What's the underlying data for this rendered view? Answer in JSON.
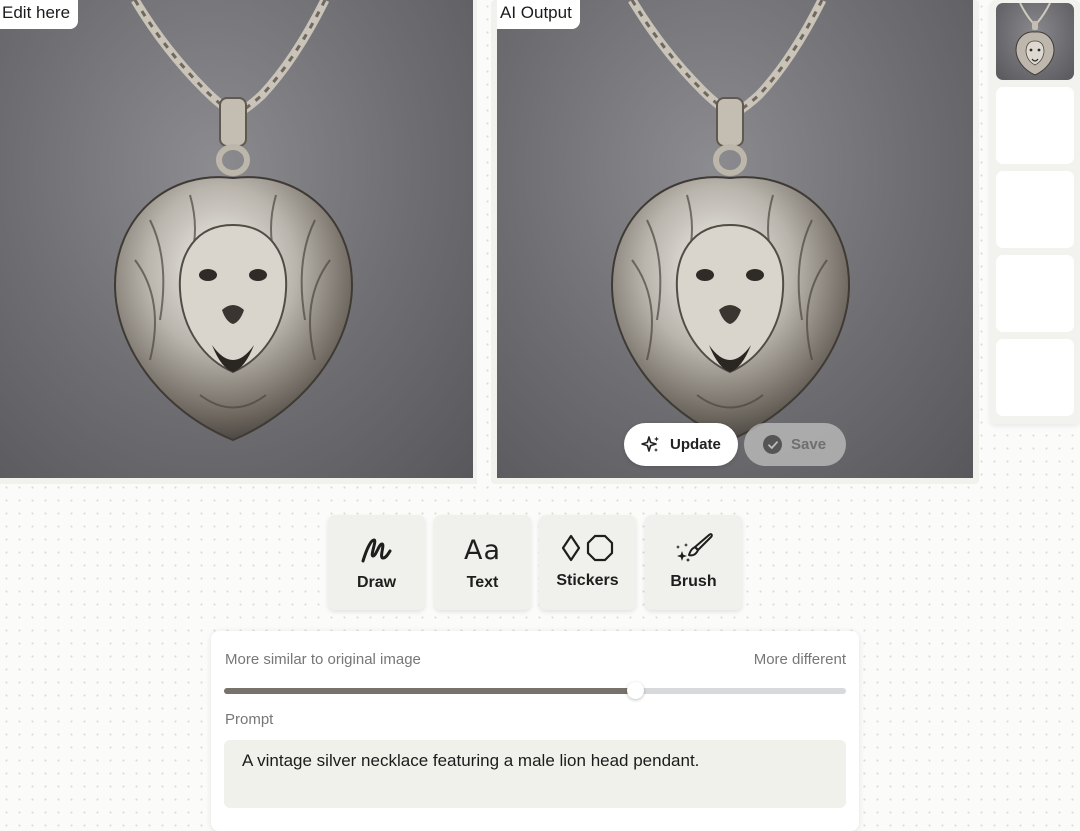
{
  "edit_canvas": {
    "label": "Edit here"
  },
  "output_canvas": {
    "label": "AI Output",
    "update_label": "Update",
    "save_label": "Save"
  },
  "thumbnails": [
    {
      "state": "active",
      "icon": "lion-pendant-thumbnail"
    },
    {
      "state": "empty"
    },
    {
      "state": "empty"
    },
    {
      "state": "empty"
    },
    {
      "state": "empty"
    }
  ],
  "tools": [
    {
      "label": "Draw",
      "icon": "draw-icon"
    },
    {
      "label": "Text",
      "icon": "text-icon",
      "glyph": "Aa"
    },
    {
      "label": "Stickers",
      "icon": "stickers-icon"
    },
    {
      "label": "Brush",
      "icon": "brush-icon"
    }
  ],
  "similarity": {
    "left_label": "More similar to original image",
    "right_label": "More different",
    "value": 0.66
  },
  "prompt": {
    "label": "Prompt",
    "value": "A vintage silver necklace featuring a male lion head pendant."
  },
  "colors": {
    "background": "#fbfbf9",
    "canvas_grey": "#6e6e72",
    "slider_fill": "#77726b",
    "slider_track": "#d7d9db",
    "prompt_bg": "#f1f1ec"
  }
}
